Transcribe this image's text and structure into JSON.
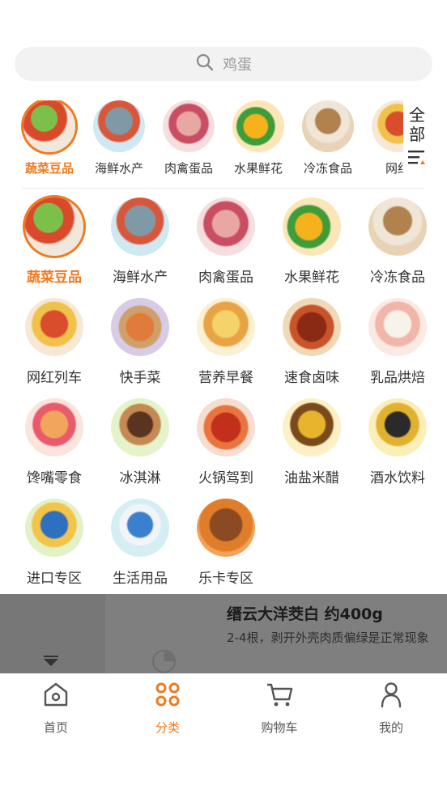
{
  "search": {
    "placeholder": "鸡蛋"
  },
  "quick_categories": [
    {
      "label": "蔬菜豆品",
      "icon": "vegetable-icon",
      "active": true
    },
    {
      "label": "海鲜水产",
      "icon": "seafood-icon"
    },
    {
      "label": "肉禽蛋品",
      "icon": "meat-icon"
    },
    {
      "label": "水果鲜花",
      "icon": "fruit-icon"
    },
    {
      "label": "冷冻食品",
      "icon": "frozen-food-icon"
    },
    {
      "label": "网红",
      "icon": "trending-icon"
    }
  ],
  "all_toggle": {
    "label": "全部"
  },
  "categories": [
    {
      "label": "蔬菜豆品",
      "icon": "vegetable-icon",
      "active": true
    },
    {
      "label": "海鲜水产",
      "icon": "seafood-icon"
    },
    {
      "label": "肉禽蛋品",
      "icon": "meat-icon"
    },
    {
      "label": "水果鲜花",
      "icon": "fruit-icon"
    },
    {
      "label": "冷冻食品",
      "icon": "frozen-food-icon"
    },
    {
      "label": "网红列车",
      "icon": "trending-icon"
    },
    {
      "label": "快手菜",
      "icon": "quick-dish-icon"
    },
    {
      "label": "营养早餐",
      "icon": "breakfast-icon"
    },
    {
      "label": "速食卤味",
      "icon": "instant-food-icon"
    },
    {
      "label": "乳品烘焙",
      "icon": "dairy-icon"
    },
    {
      "label": "馋嘴零食",
      "icon": "snack-icon"
    },
    {
      "label": "冰淇淋",
      "icon": "ice-cream-icon"
    },
    {
      "label": "火锅驾到",
      "icon": "hotpot-icon"
    },
    {
      "label": "油盐米醋",
      "icon": "condiment-icon"
    },
    {
      "label": "酒水饮料",
      "icon": "drink-icon"
    },
    {
      "label": "进口专区",
      "icon": "import-icon"
    },
    {
      "label": "生活用品",
      "icon": "daily-goods-icon"
    },
    {
      "label": "乐卡专区",
      "icon": "vip-icon"
    }
  ],
  "overlay_product": {
    "title": "缙云大洋茭白 约400g",
    "description": "2-4根，剥开外壳肉质偏绿是正常现象"
  },
  "tabbar": [
    {
      "label": "首页",
      "icon": "home-icon"
    },
    {
      "label": "分类",
      "icon": "category-icon",
      "active": true
    },
    {
      "label": "购物车",
      "icon": "cart-icon"
    },
    {
      "label": "我的",
      "icon": "profile-icon"
    }
  ],
  "colors": {
    "accent": "#f07a1f",
    "overlay": "#7f7f7f"
  }
}
